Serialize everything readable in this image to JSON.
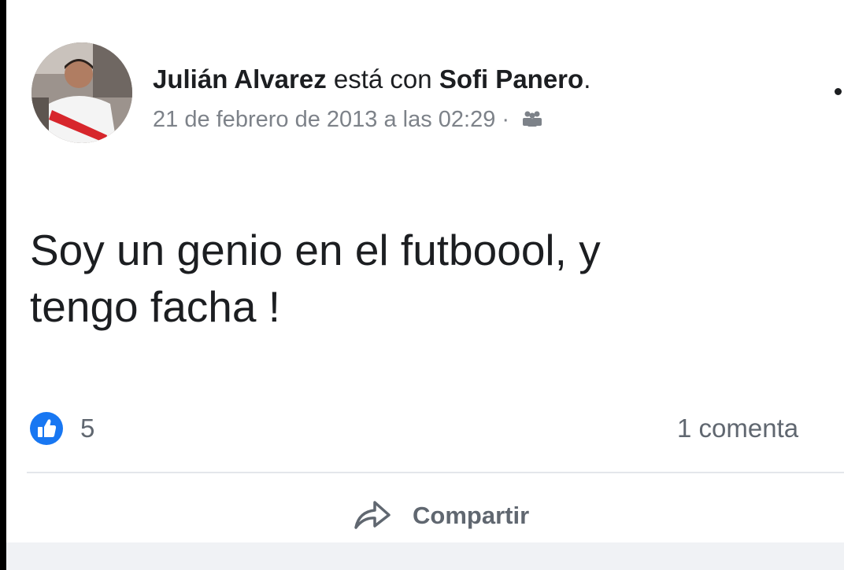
{
  "post": {
    "author": "Julián Alvarez",
    "connector": " está con ",
    "tagged": "Sofi Panero",
    "period": ".",
    "timestamp": "21 de febrero de 2013 a las 02:29 · ",
    "audience_icon": "friends-icon",
    "body_line1": "Soy un genio en el futboool, y",
    "body_line2": "tengo facha !"
  },
  "reactions": {
    "like_icon": "like-icon",
    "like_count": "5",
    "comment_count": "1 comenta"
  },
  "actions": {
    "share_icon": "share-icon",
    "share_label": "Compartir"
  },
  "colors": {
    "like_blue": "#1877f2",
    "text": "#1c1e21",
    "muted": "#606770"
  }
}
